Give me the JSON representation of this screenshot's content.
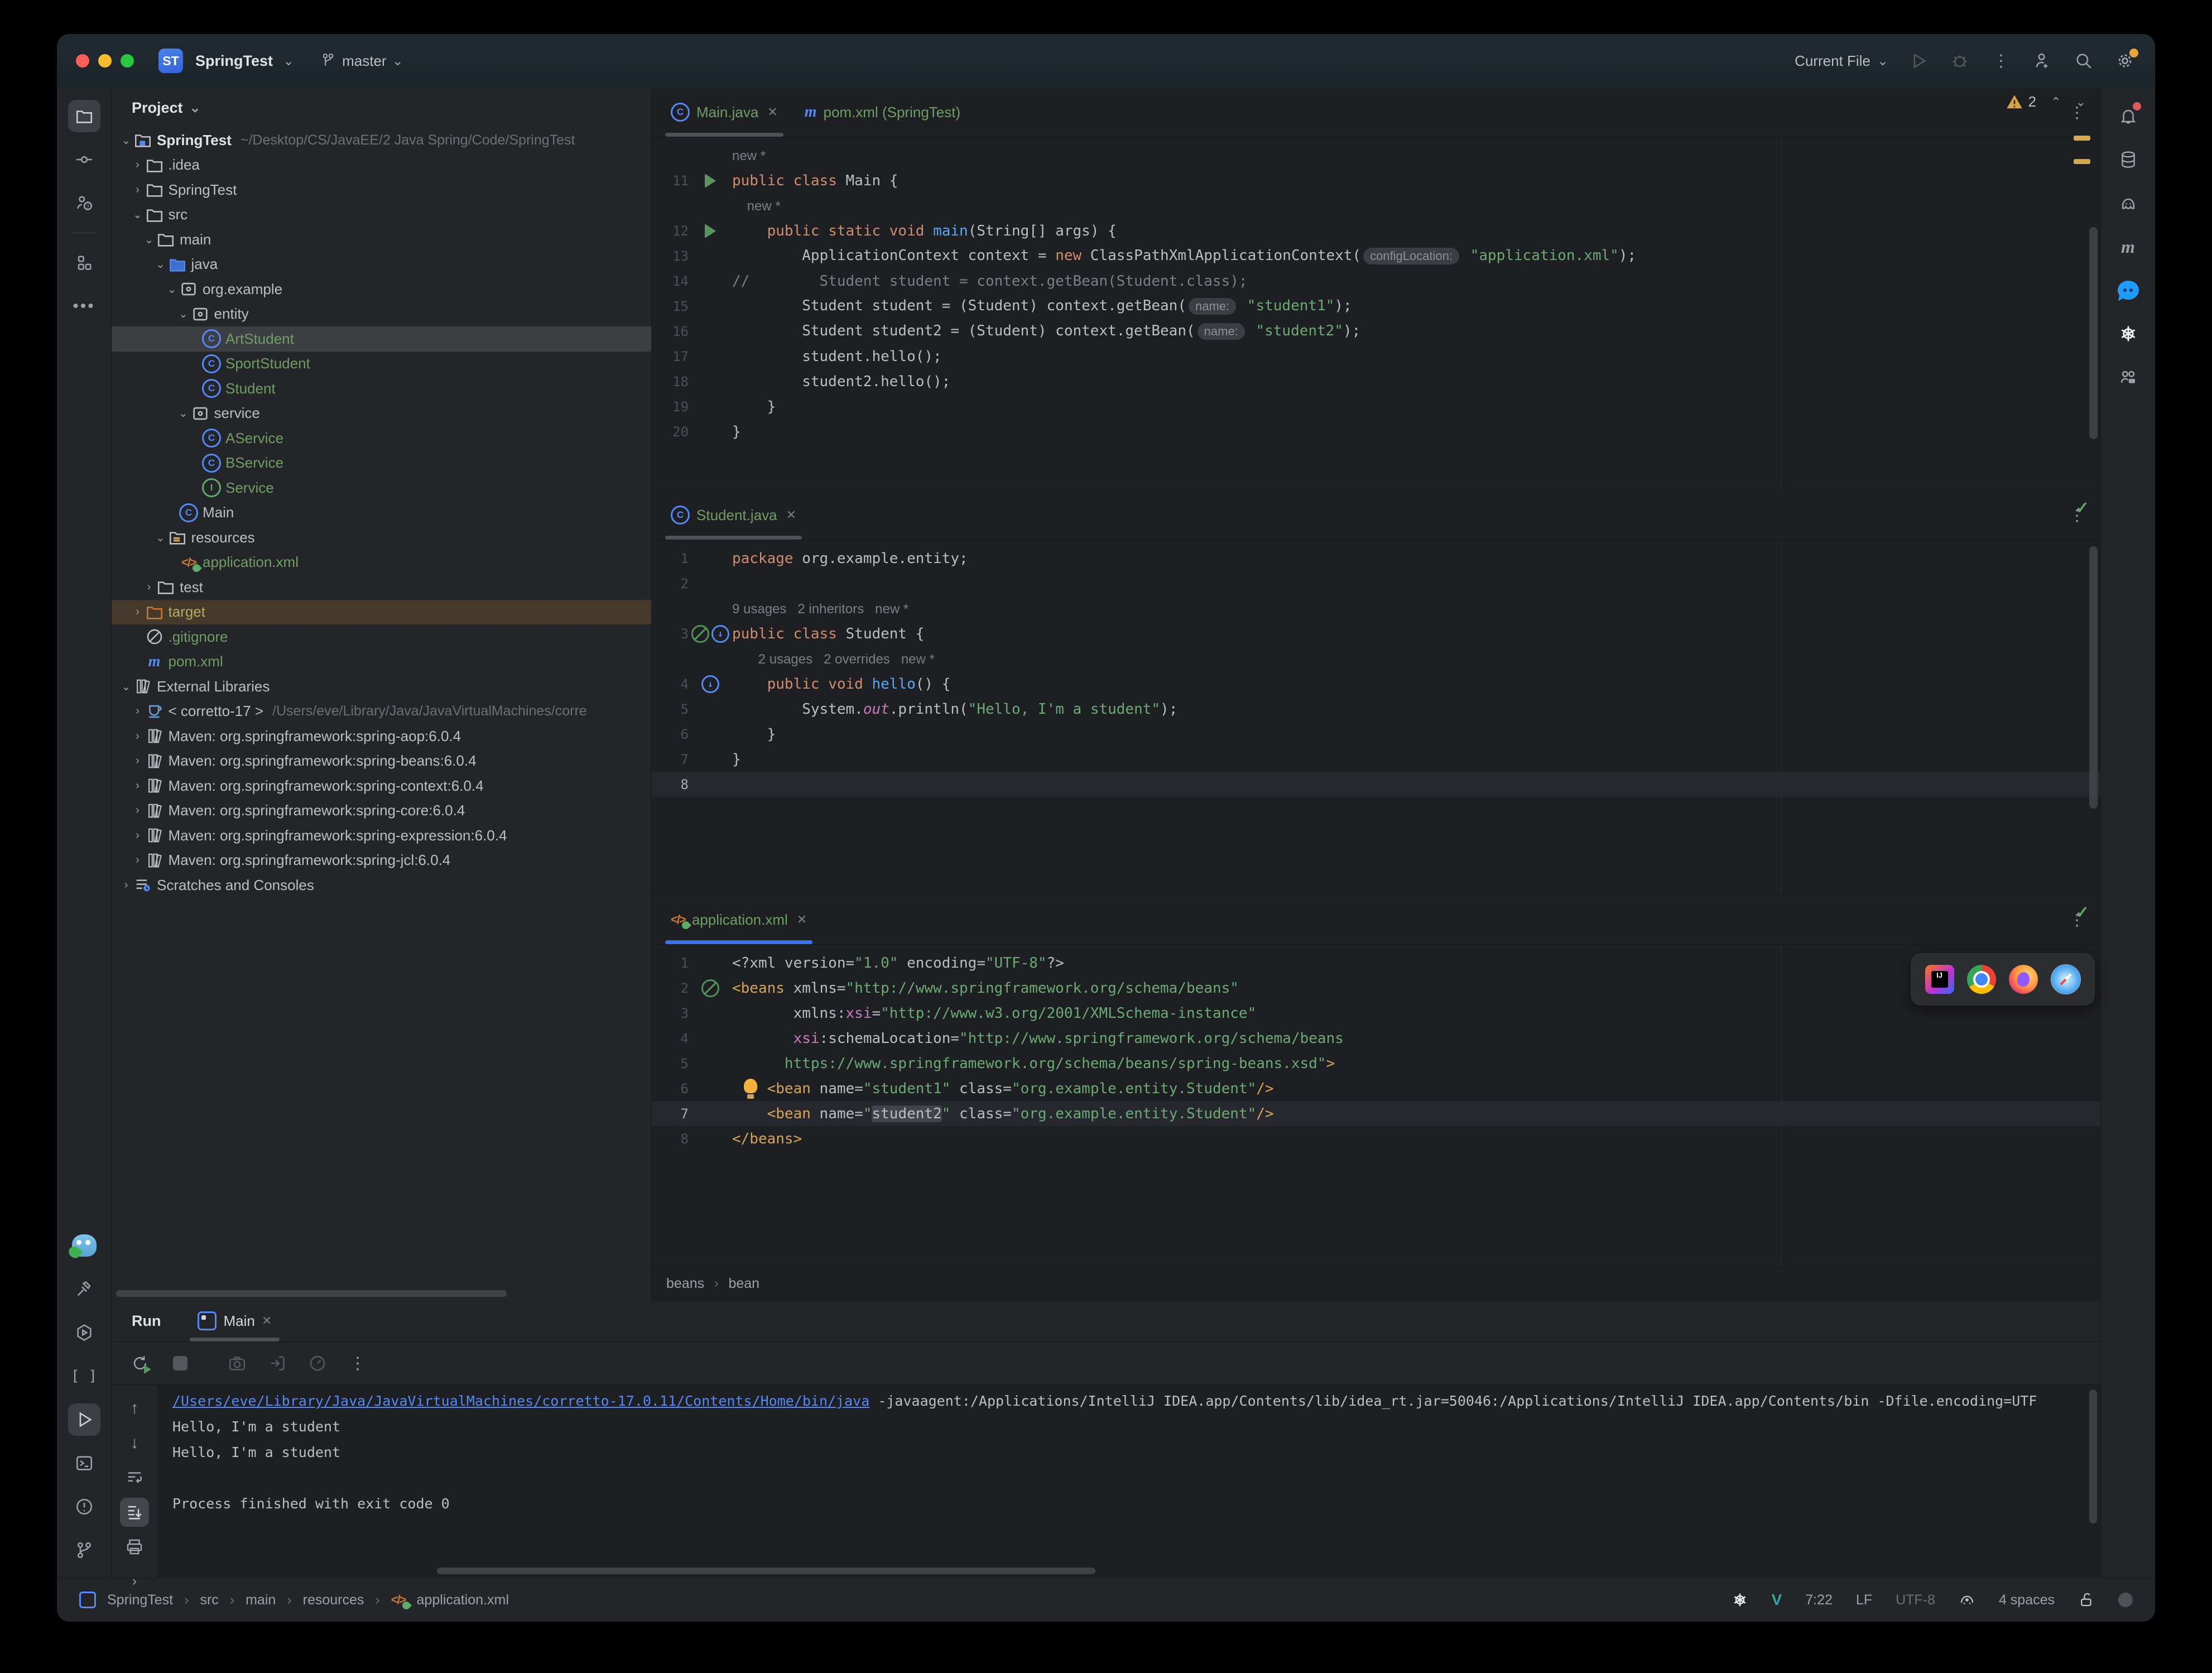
{
  "titlebar": {
    "badge": "ST",
    "project": "SpringTest",
    "branch": "master",
    "run_config": "Current File",
    "right_icons": [
      "play-icon",
      "debug-icon",
      "more-icon",
      "add-user-icon",
      "search-icon",
      "settings-icon"
    ]
  },
  "left_stripe_top": [
    {
      "icon": "project-folder",
      "selected": true
    },
    {
      "icon": "commit"
    },
    {
      "icon": "pull-requests"
    },
    {
      "icon": "divider"
    },
    {
      "icon": "structure"
    },
    {
      "icon": "more-h"
    }
  ],
  "left_stripe_bottom": [
    {
      "icon": "gopher"
    },
    {
      "icon": "build-hammer"
    },
    {
      "icon": "services"
    },
    {
      "icon": "brackets"
    },
    {
      "icon": "run-play",
      "selected": true
    },
    {
      "icon": "terminal"
    },
    {
      "icon": "problems"
    },
    {
      "icon": "git-branch"
    }
  ],
  "right_stripe": [
    {
      "icon": "notifications",
      "badge": true
    },
    {
      "icon": "database"
    },
    {
      "icon": "gradle"
    },
    {
      "icon": "maven"
    },
    {
      "icon": "chat"
    },
    {
      "icon": "openai"
    },
    {
      "icon": "code-with-me"
    }
  ],
  "project": {
    "header": "Project",
    "tree": [
      {
        "lvl": 0,
        "chev": "v",
        "icon": "project",
        "label": "SpringTest",
        "bold": true,
        "path": "~/Desktop/CS/JavaEE/2 Java Spring/Code/SpringTest"
      },
      {
        "lvl": 1,
        "chev": ">",
        "icon": "folder",
        "label": ".idea"
      },
      {
        "lvl": 1,
        "chev": ">",
        "icon": "folder",
        "label": "SpringTest"
      },
      {
        "lvl": 1,
        "chev": "v",
        "icon": "folder",
        "label": "src"
      },
      {
        "lvl": 2,
        "chev": "v",
        "icon": "folder",
        "label": "main"
      },
      {
        "lvl": 3,
        "chev": "v",
        "icon": "folder-java",
        "label": "java"
      },
      {
        "lvl": 4,
        "chev": "v",
        "icon": "package",
        "label": "org.example"
      },
      {
        "lvl": 5,
        "chev": "v",
        "icon": "package",
        "label": "entity"
      },
      {
        "lvl": 6,
        "chev": "",
        "icon": "class",
        "label": "ArtStudent",
        "cls": "green",
        "selected": true
      },
      {
        "lvl": 6,
        "chev": "",
        "icon": "class",
        "label": "SportStudent",
        "cls": "green"
      },
      {
        "lvl": 6,
        "chev": "",
        "icon": "class",
        "label": "Student",
        "cls": "green"
      },
      {
        "lvl": 5,
        "chev": "v",
        "icon": "package",
        "label": "service"
      },
      {
        "lvl": 6,
        "chev": "",
        "icon": "class",
        "label": "AService",
        "cls": "green"
      },
      {
        "lvl": 6,
        "chev": "",
        "icon": "class",
        "label": "BService",
        "cls": "green"
      },
      {
        "lvl": 6,
        "chev": "",
        "icon": "interface",
        "label": "Service",
        "cls": "green"
      },
      {
        "lvl": 4,
        "chev": "",
        "icon": "class",
        "label": "Main"
      },
      {
        "lvl": 3,
        "chev": "v",
        "icon": "folder-res",
        "label": "resources"
      },
      {
        "lvl": 4,
        "chev": "",
        "icon": "springxml",
        "label": "application.xml",
        "cls": "green"
      },
      {
        "lvl": 2,
        "chev": ">",
        "icon": "folder",
        "label": "test"
      },
      {
        "lvl": 1,
        "chev": ">",
        "icon": "folder-excl",
        "label": "target",
        "cls": "excl",
        "target": true
      },
      {
        "lvl": 1,
        "chev": "",
        "icon": "ignored",
        "label": ".gitignore",
        "cls": "green"
      },
      {
        "lvl": 1,
        "chev": "",
        "icon": "maven-m",
        "label": "pom.xml",
        "cls": "green"
      },
      {
        "lvl": 0,
        "chev": "v",
        "icon": "library",
        "label": "External Libraries"
      },
      {
        "lvl": 1,
        "chev": ">",
        "icon": "jdk",
        "label": "< corretto-17 >",
        "path": "/Users/eve/Library/Java/JavaVirtualMachines/corre"
      },
      {
        "lvl": 1,
        "chev": ">",
        "icon": "library",
        "label": "Maven: org.springframework:spring-aop:6.0.4"
      },
      {
        "lvl": 1,
        "chev": ">",
        "icon": "library",
        "label": "Maven: org.springframework:spring-beans:6.0.4"
      },
      {
        "lvl": 1,
        "chev": ">",
        "icon": "library",
        "label": "Maven: org.springframework:spring-context:6.0.4"
      },
      {
        "lvl": 1,
        "chev": ">",
        "icon": "library",
        "label": "Maven: org.springframework:spring-core:6.0.4"
      },
      {
        "lvl": 1,
        "chev": ">",
        "icon": "library",
        "label": "Maven: org.springframework:spring-expression:6.0.4"
      },
      {
        "lvl": 1,
        "chev": ">",
        "icon": "library",
        "label": "Maven: org.springframework:spring-jcl:6.0.4"
      },
      {
        "lvl": 0,
        "chev": ">",
        "icon": "scratches",
        "label": "Scratches and Consoles"
      }
    ]
  },
  "editors": [
    {
      "tabs": [
        {
          "icon": "class",
          "label": "Main.java",
          "close": true,
          "underline": "gray"
        },
        {
          "icon": "maven-m",
          "label": "pom.xml (SpringTest)",
          "close": false,
          "underline": ""
        }
      ],
      "warning_count": "2",
      "lines": [
        {
          "n": "",
          "g": "",
          "tokens": [
            [
              "h",
              "new *"
            ]
          ]
        },
        {
          "n": "11",
          "g": "run",
          "tokens": [
            [
              "k",
              "public"
            ],
            [
              "d",
              " "
            ],
            [
              "k",
              "class"
            ],
            [
              "d",
              " Main {"
            ]
          ]
        },
        {
          "n": "",
          "g": "",
          "tokens": [
            [
              "h",
              "    new *"
            ]
          ]
        },
        {
          "n": "12",
          "g": "run",
          "tokens": [
            [
              "d",
              "    "
            ],
            [
              "k",
              "public"
            ],
            [
              "d",
              " "
            ],
            [
              "k",
              "static"
            ],
            [
              "d",
              " "
            ],
            [
              "k",
              "void"
            ],
            [
              "d",
              " "
            ],
            [
              "m",
              "main"
            ],
            [
              "d",
              "(String[] args) {"
            ]
          ]
        },
        {
          "n": "13",
          "g": "",
          "tokens": [
            [
              "d",
              "        ApplicationContext context = "
            ],
            [
              "k",
              "new"
            ],
            [
              "d",
              " ClassPathXmlApplicationContext("
            ],
            [
              "p",
              "configLocation:"
            ],
            [
              "d",
              " "
            ],
            [
              "s",
              "\"application.xml\""
            ],
            [
              "d",
              ");"
            ]
          ]
        },
        {
          "n": "14",
          "g": "",
          "tokens": [
            [
              "c",
              "//        Student student = context.getBean(Student.class);"
            ]
          ]
        },
        {
          "n": "15",
          "g": "",
          "tokens": [
            [
              "d",
              "        Student student = (Student) context.getBean("
            ],
            [
              "p",
              "name:"
            ],
            [
              "d",
              " "
            ],
            [
              "s",
              "\"student1\""
            ],
            [
              "d",
              ");"
            ]
          ]
        },
        {
          "n": "16",
          "g": "",
          "tokens": [
            [
              "d",
              "        Student student2 = (Student) context.getBean("
            ],
            [
              "p",
              "name:"
            ],
            [
              "d",
              " "
            ],
            [
              "s",
              "\"student2\""
            ],
            [
              "d",
              ");"
            ]
          ]
        },
        {
          "n": "17",
          "g": "",
          "tokens": [
            [
              "d",
              "        student.hello();"
            ]
          ]
        },
        {
          "n": "18",
          "g": "",
          "tokens": [
            [
              "d",
              "        student2.hello();"
            ]
          ]
        },
        {
          "n": "19",
          "g": "",
          "tokens": [
            [
              "d",
              "    }"
            ]
          ]
        },
        {
          "n": "20",
          "g": "",
          "tokens": [
            [
              "d",
              "}"
            ]
          ]
        }
      ]
    },
    {
      "tabs": [
        {
          "icon": "class",
          "label": "Student.java",
          "close": true,
          "underline": "gray"
        }
      ],
      "ok_check": true,
      "lines": [
        {
          "n": "1",
          "g": "",
          "tokens": [
            [
              "k",
              "package"
            ],
            [
              "d",
              " org.example.entity;"
            ]
          ]
        },
        {
          "n": "2",
          "g": "",
          "tokens": []
        },
        {
          "n": "",
          "g": "",
          "tokens": [
            [
              "h",
              "9 usages   2 inheritors   new *"
            ]
          ]
        },
        {
          "n": "3",
          "g": "bean2",
          "tokens": [
            [
              "k",
              "public"
            ],
            [
              "d",
              " "
            ],
            [
              "k",
              "class"
            ],
            [
              "d",
              " Student {"
            ]
          ]
        },
        {
          "n": "",
          "g": "",
          "tokens": [
            [
              "h",
              "       2 usages   2 overrides   new *"
            ]
          ]
        },
        {
          "n": "4",
          "g": "ovr",
          "tokens": [
            [
              "d",
              "    "
            ],
            [
              "k",
              "public"
            ],
            [
              "d",
              " "
            ],
            [
              "k",
              "void"
            ],
            [
              "d",
              " "
            ],
            [
              "m",
              "hello"
            ],
            [
              "d",
              "() {"
            ]
          ]
        },
        {
          "n": "5",
          "g": "",
          "tokens": [
            [
              "d",
              "        System."
            ],
            [
              "f",
              "out"
            ],
            [
              "d",
              ".println("
            ],
            [
              "s",
              "\"Hello, I'm a student\""
            ],
            [
              "d",
              ");"
            ]
          ]
        },
        {
          "n": "6",
          "g": "",
          "tokens": [
            [
              "d",
              "    }"
            ]
          ]
        },
        {
          "n": "7",
          "g": "",
          "tokens": [
            [
              "d",
              "}"
            ]
          ]
        },
        {
          "n": "8",
          "g": "",
          "current": true,
          "tokens": []
        }
      ]
    },
    {
      "tabs": [
        {
          "icon": "springxml",
          "label": "application.xml",
          "close": true,
          "underline": "blue"
        }
      ],
      "ok_check": true,
      "browsers": [
        "intellij",
        "chrome",
        "firefox",
        "safari"
      ],
      "breadcrumbs": [
        "beans",
        "bean"
      ],
      "lines": [
        {
          "n": "1",
          "g": "",
          "tokens": [
            [
              "d",
              "<?xml version="
            ],
            [
              "s",
              "\"1.0\""
            ],
            [
              "d",
              " encoding="
            ],
            [
              "s",
              "\"UTF-8\""
            ],
            [
              "d",
              "?>"
            ]
          ]
        },
        {
          "n": "2",
          "g": "bean",
          "tokens": [
            [
              "t",
              "<beans"
            ],
            [
              "d",
              " xmlns="
            ],
            [
              "s",
              "\"http://www.springframework.org/schema/beans\""
            ]
          ]
        },
        {
          "n": "3",
          "g": "",
          "tokens": [
            [
              "d",
              "       xmlns:"
            ],
            [
              "x",
              "xsi"
            ],
            [
              "d",
              "="
            ],
            [
              "s",
              "\"http://www.w3.org/2001/XMLSchema-instance\""
            ]
          ]
        },
        {
          "n": "4",
          "g": "",
          "tokens": [
            [
              "d",
              "       "
            ],
            [
              "x",
              "xsi"
            ],
            [
              "d",
              ":schemaLocation="
            ],
            [
              "s",
              "\"http://www.springframework.org/schema/beans"
            ]
          ]
        },
        {
          "n": "5",
          "g": "",
          "tokens": [
            [
              "d",
              "      "
            ],
            [
              "s",
              "https://www.springframework.org/schema/beans/spring-beans.xsd\""
            ],
            [
              "t",
              ">"
            ]
          ]
        },
        {
          "n": "6",
          "g": "",
          "tokens": [
            [
              "d",
              "    "
            ],
            [
              "bulb",
              ""
            ],
            [
              "t",
              "<bean"
            ],
            [
              "d",
              " name="
            ],
            [
              "s",
              "\"student1\""
            ],
            [
              "d",
              " class="
            ],
            [
              "s",
              "\"org.example.entity.Student\""
            ],
            [
              "t",
              "/>"
            ]
          ]
        },
        {
          "n": "7",
          "g": "",
          "current": true,
          "tokens": [
            [
              "d",
              "    "
            ],
            [
              "t",
              "<bean"
            ],
            [
              "d",
              " name="
            ],
            [
              "s",
              "\""
            ],
            [
              "sel",
              "student2"
            ],
            [
              "s",
              "\""
            ],
            [
              "d",
              " class="
            ],
            [
              "s",
              "\"org.example.entity.Student\""
            ],
            [
              "t",
              "/>"
            ]
          ]
        },
        {
          "n": "8",
          "g": "",
          "tokens": [
            [
              "t",
              "</beans>"
            ]
          ]
        }
      ]
    }
  ],
  "run_panel": {
    "title": "Run",
    "tab": "Main",
    "toolbar_icons": [
      "rerun",
      "stop",
      "separator",
      "camera",
      "attach",
      "gauge",
      "kebab"
    ],
    "side_icons": [
      "up",
      "down",
      "soft-wrap",
      "scroll-end-selected",
      "print",
      "expand"
    ],
    "console": [
      [
        [
          "lnk",
          "/Users/eve/Library/Java/JavaVirtualMachines/corretto-17.0.11/Contents/Home/bin/java"
        ],
        [
          "d",
          " -javaagent:/Applications/IntelliJ IDEA.app/Contents/lib/idea_rt.jar=50046:/Applications/IntelliJ IDEA.app/Contents/bin -Dfile.encoding=UTF"
        ]
      ],
      [
        [
          "d",
          "Hello, I'm a student"
        ]
      ],
      [
        [
          "d",
          "Hello, I'm a student"
        ]
      ],
      [],
      [
        [
          "d",
          "Process finished with exit code 0"
        ]
      ]
    ]
  },
  "status_bar": {
    "breadcrumbs": [
      "SpringTest",
      "src",
      "main",
      "resources",
      "application.xml"
    ],
    "time": "7:22",
    "line_ending": "LF",
    "encoding": "UTF-8",
    "indent": "4 spaces"
  }
}
